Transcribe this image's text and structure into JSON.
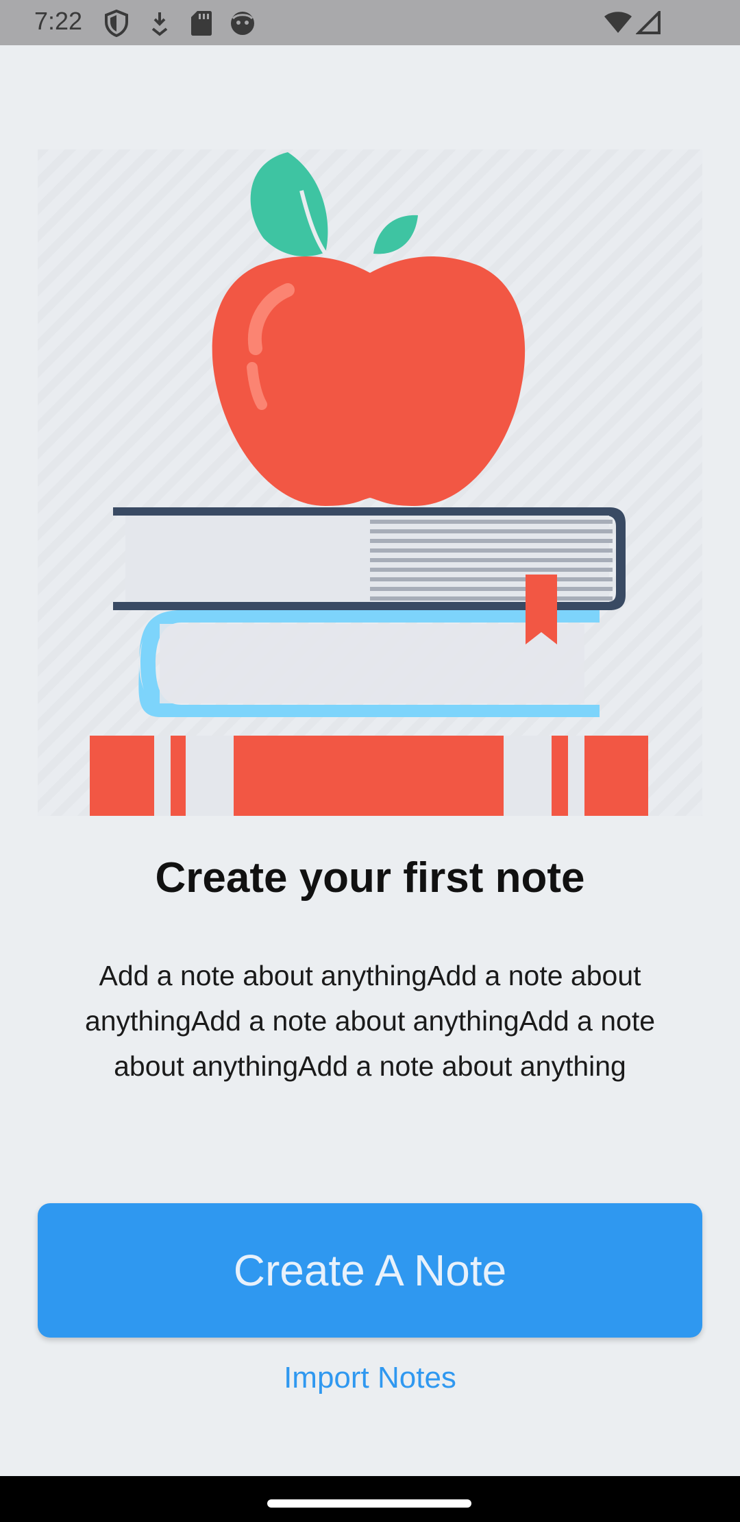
{
  "status_bar": {
    "time": "7:22",
    "left_icons": [
      "shield-icon",
      "download-icon",
      "sd-card-icon",
      "face-icon"
    ],
    "right_icons": [
      "wifi-icon",
      "cell-signal-icon"
    ]
  },
  "illustration": {
    "icon": "apple-on-books-icon",
    "colors": {
      "apple": "#f25744",
      "leaf": "#3ec4a2",
      "book_dark": "#394a63",
      "book_blue": "#7dd4fb",
      "book_red": "#f25744",
      "page": "#e4e7ec"
    }
  },
  "empty_state": {
    "title": "Create your first note",
    "description": "Add a note about anythingAdd a note about anythingAdd a note about anythingAdd a note about anythingAdd a note about anything"
  },
  "actions": {
    "primary_label": "Create A Note",
    "secondary_label": "Import Notes"
  },
  "colors": {
    "background": "#ebeef1",
    "accent": "#2f98f0",
    "status_bar": "#a9a9ab"
  }
}
